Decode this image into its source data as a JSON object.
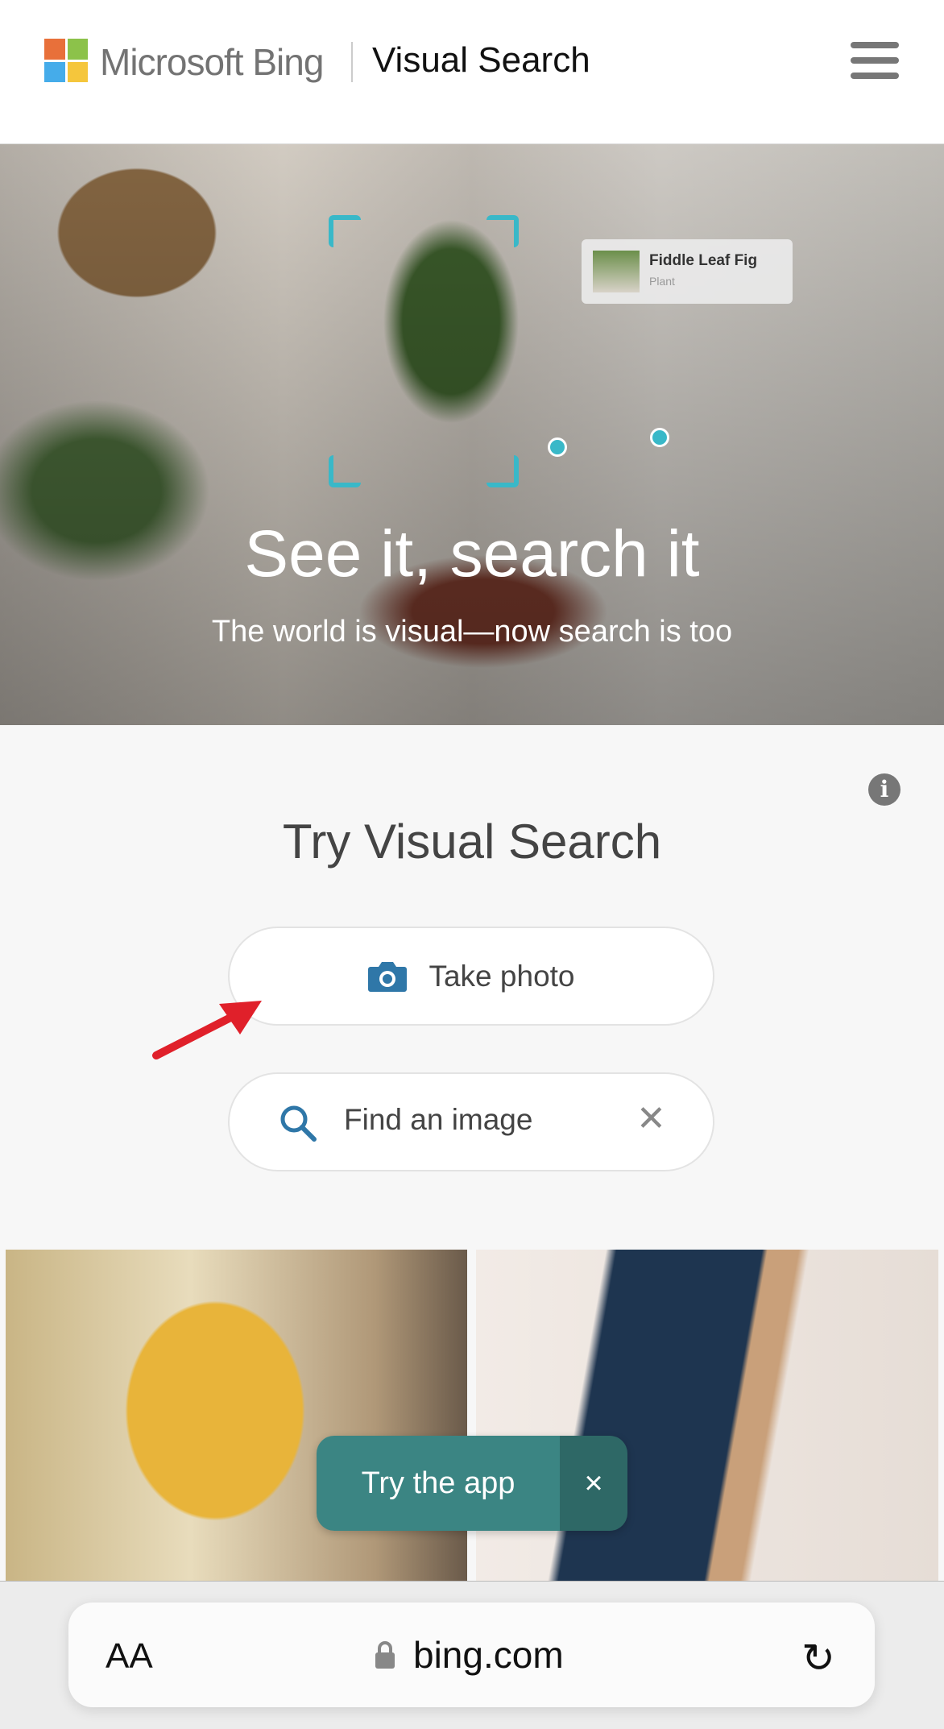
{
  "header": {
    "brand": "Microsoft Bing",
    "product": "Visual Search",
    "menu_icon": "hamburger-menu-icon"
  },
  "hero": {
    "title": "See it, search it",
    "subtitle": "The world is visual—now search is too",
    "tag": {
      "name": "Fiddle Leaf Fig",
      "type": "Plant"
    },
    "accent": "#39b8c8"
  },
  "try": {
    "title": "Try Visual Search",
    "take_photo": "Take photo",
    "find_image_placeholder": "Find an image",
    "icon_color": "#2f77a8"
  },
  "app_banner": {
    "label": "Try the app",
    "close": "×",
    "color": "#3b8583"
  },
  "browser": {
    "text_size": "AA",
    "domain": "bing.com"
  }
}
